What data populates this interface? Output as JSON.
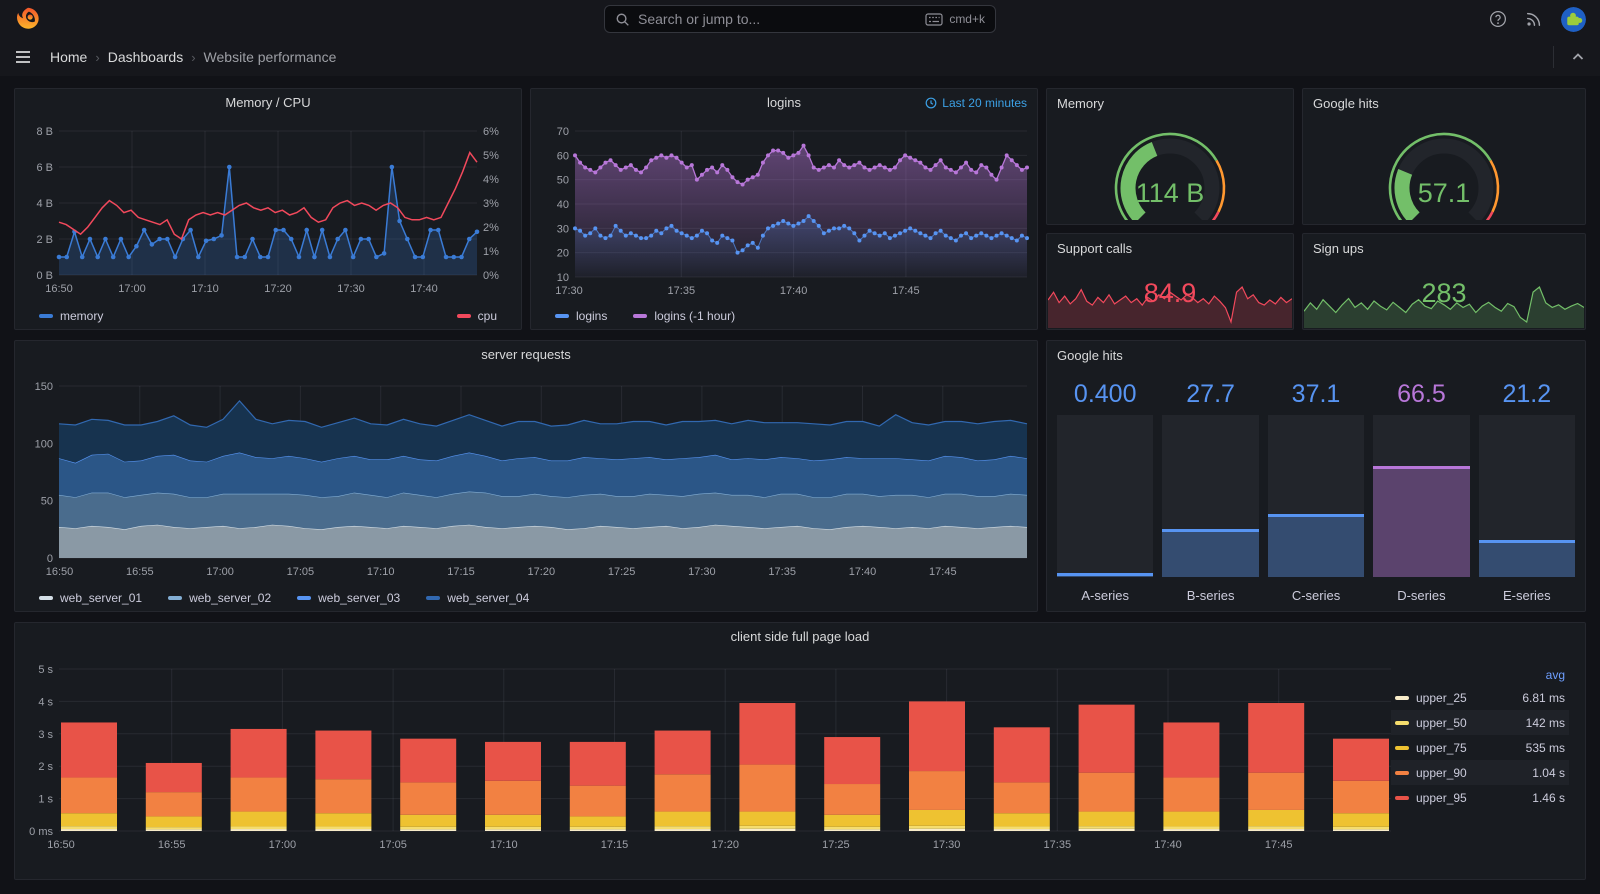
{
  "topbar": {
    "search_placeholder": "Search or jump to...",
    "search_shortcut": "cmd+k"
  },
  "breadcrumb": {
    "home": "Home",
    "section": "Dashboards",
    "current": "Website performance",
    "separator": "›"
  },
  "colors": {
    "background": "#111217",
    "panel": "#181b20",
    "blue": "#5794F2",
    "memory_blue": "#3A7BD5",
    "purple": "#B877D9",
    "red": "#F2495C",
    "green": "#73BF69",
    "orange": "#FF9830",
    "link_blue": "#6E9FFF",
    "time_badge_blue": "#3CA1E6"
  },
  "panels": {
    "mem_cpu": {
      "title": "Memory / CPU",
      "chart_data": {
        "type": "line",
        "x_ticks": [
          "16:50",
          "17:00",
          "17:10",
          "17:20",
          "17:30",
          "17:40"
        ],
        "y_left": {
          "ticks": [
            "0 B",
            "2 B",
            "4 B",
            "6 B",
            "8 B"
          ],
          "lim": [
            0,
            8
          ]
        },
        "y_right": {
          "ticks": [
            "0%",
            "1%",
            "2%",
            "3%",
            "4%",
            "5%",
            "6%"
          ],
          "lim": [
            0,
            6
          ]
        },
        "series": [
          {
            "name": "memory",
            "axis": "left",
            "color": "#3A7BD5",
            "fill": "rgba(58,123,213,0.22)",
            "values": [
              1,
              1,
              2.4,
              1,
              2,
              1,
              2,
              1,
              2,
              1,
              1.6,
              2.5,
              1.7,
              2,
              2,
              1,
              2,
              2.5,
              1,
              1.9,
              2,
              2.2,
              6,
              1,
              1,
              2,
              1,
              1,
              2.5,
              2.5,
              2,
              1,
              2.5,
              1,
              2.5,
              1,
              2,
              2.5,
              1,
              2,
              2,
              1,
              1.2,
              6,
              3,
              2,
              1,
              1,
              2.5,
              2.5,
              1,
              1,
              1,
              2,
              2.4
            ]
          },
          {
            "name": "cpu",
            "axis": "right",
            "color": "#F2495C",
            "values": [
              2.2,
              2.1,
              1.9,
              1.7,
              2.0,
              2.4,
              2.8,
              3.1,
              2.9,
              2.6,
              2.7,
              2.4,
              2.3,
              2.2,
              2.1,
              2.3,
              1.7,
              1.5,
              2.3,
              2.5,
              2.6,
              2.5,
              2.6,
              2.5,
              2.7,
              2.9,
              3.0,
              2.8,
              2.7,
              2.8,
              2.6,
              2.7,
              2.5,
              2.6,
              2.8,
              2.4,
              2.2,
              2.3,
              2.8,
              3.0,
              3.1,
              2.9,
              3.0,
              2.9,
              2.7,
              2.9,
              3.0,
              2.8,
              2.4,
              2.3,
              2.3,
              2.4,
              2.3,
              2.4,
              3.0,
              3.6,
              4.3,
              5.1,
              4.7
            ]
          }
        ]
      }
    },
    "logins": {
      "title": "logins",
      "time_badge": "Last 20 minutes",
      "chart_data": {
        "type": "line",
        "x_ticks": [
          "17:30",
          "17:35",
          "17:40",
          "17:45"
        ],
        "ylim": [
          10,
          70
        ],
        "y_ticks": [
          "10",
          "20",
          "30",
          "40",
          "50",
          "60",
          "70"
        ],
        "series": [
          {
            "name": "logins",
            "color": "#5794F2",
            "values": [
              30,
              29,
              27,
              28,
              30,
              27,
              26,
              27,
              31,
              29,
              27,
              28,
              27,
              26,
              26,
              27,
              29,
              28,
              30,
              31,
              29,
              28,
              27,
              26,
              27,
              29,
              28,
              25,
              24,
              27,
              26,
              25,
              20,
              21,
              23,
              24,
              22,
              27,
              30,
              31,
              32,
              33,
              32,
              31,
              32,
              33,
              35,
              33,
              31,
              28,
              29,
              30,
              30,
              31,
              30,
              28,
              25,
              27,
              29,
              28,
              27,
              28,
              26,
              27,
              28,
              29,
              30,
              29,
              28,
              27,
              26,
              28,
              29,
              27,
              26,
              25,
              27,
              28,
              26,
              27,
              28,
              27,
              26,
              27,
              28,
              27,
              26,
              25,
              27,
              26
            ]
          },
          {
            "name": "logins (-1 hour)",
            "color": "#B877D9",
            "values": [
              60,
              57,
              55,
              54,
              53,
              55,
              57,
              58,
              56,
              54,
              55,
              56,
              54,
              53,
              55,
              58,
              59,
              60,
              59,
              60,
              59,
              57,
              55,
              56,
              50,
              52,
              54,
              55,
              53,
              56,
              54,
              51,
              49,
              48,
              50,
              51,
              52,
              57,
              60,
              62,
              62,
              61,
              59,
              60,
              61,
              64,
              60,
              55,
              54,
              55,
              56,
              55,
              58,
              56,
              55,
              56,
              57,
              55,
              54,
              55,
              56,
              55,
              54,
              55,
              58,
              60,
              59,
              58,
              57,
              55,
              54,
              56,
              58,
              55,
              54,
              53,
              55,
              57,
              54,
              53,
              56,
              55,
              52,
              50,
              55,
              60,
              58,
              56,
              54,
              55
            ]
          }
        ]
      }
    },
    "memory_gauge": {
      "title": "Memory",
      "value": "114 B",
      "value_color": "#73BF69",
      "fill_fraction": 0.42,
      "thresholds": [
        {
          "to": 0.72,
          "color": "#73BF69"
        },
        {
          "to": 0.93,
          "color": "#FF9830"
        },
        {
          "to": 1,
          "color": "#F2495C"
        }
      ]
    },
    "google_gauge": {
      "title": "Google hits",
      "value": "57.1",
      "value_color": "#73BF69",
      "fill_fraction": 0.25,
      "thresholds": [
        {
          "to": 0.72,
          "color": "#73BF69"
        },
        {
          "to": 0.93,
          "color": "#FF9830"
        },
        {
          "to": 1,
          "color": "#F2495C"
        }
      ]
    },
    "support_calls": {
      "title": "Support calls",
      "value": "84.9",
      "color": "#F2495C",
      "spark": [
        82,
        88,
        80,
        85,
        79,
        83,
        90,
        81,
        78,
        84,
        80,
        86,
        79,
        82,
        85,
        80,
        83,
        78,
        84,
        81,
        86,
        83,
        88,
        85,
        82,
        86,
        84,
        80,
        83,
        79,
        85,
        81,
        76,
        65,
        88,
        92,
        83,
        86,
        80,
        78,
        82,
        79,
        84,
        80,
        83
      ]
    },
    "sign_ups": {
      "title": "Sign ups",
      "value": "283",
      "color": "#73BF69",
      "spark": [
        272,
        285,
        275,
        290,
        280,
        270,
        282,
        292,
        278,
        285,
        275,
        288,
        280,
        274,
        286,
        278,
        270,
        283,
        290,
        280,
        276,
        288,
        282,
        275,
        285,
        278,
        283,
        270,
        280,
        286,
        278,
        272,
        284,
        279,
        262,
        255,
        302,
        310,
        285,
        278,
        282,
        275,
        280,
        284,
        278
      ]
    },
    "server_requests": {
      "title": "server requests",
      "chart_data": {
        "type": "area-stacked",
        "x_ticks": [
          "16:50",
          "16:55",
          "17:00",
          "17:05",
          "17:10",
          "17:15",
          "17:20",
          "17:25",
          "17:30",
          "17:35",
          "17:40",
          "17:45"
        ],
        "ylim": [
          0,
          150
        ],
        "y_ticks": [
          "0",
          "50",
          "100",
          "150"
        ],
        "series": [
          {
            "name": "web_server_01",
            "color": "#D4DFE7",
            "fill": "#8A99A5",
            "values": [
              27,
              26,
              28,
              27,
              25,
              28,
              29,
              27,
              26,
              27,
              28,
              26,
              27,
              29,
              28,
              26,
              25,
              27,
              28,
              27,
              26,
              28,
              27,
              26,
              28,
              29,
              27,
              26,
              27,
              28,
              27,
              25,
              26,
              28,
              27,
              26,
              27,
              28,
              26,
              27,
              29,
              28,
              27,
              26,
              27,
              28,
              26,
              25,
              27,
              28,
              27,
              26,
              27,
              26,
              28,
              27,
              26,
              27,
              28,
              27
            ]
          },
          {
            "name": "web_server_02",
            "color": "#83AED4",
            "fill": "#4A6C8D",
            "values": [
              28,
              27,
              29,
              30,
              28,
              27,
              28,
              29,
              27,
              26,
              28,
              30,
              29,
              27,
              28,
              29,
              28,
              27,
              29,
              28,
              27,
              29,
              28,
              27,
              28,
              29,
              30,
              28,
              27,
              28,
              27,
              28,
              29,
              28,
              27,
              28,
              29,
              27,
              28,
              29,
              28,
              27,
              28,
              27,
              29,
              28,
              27,
              28,
              29,
              28,
              27,
              29,
              28,
              27,
              28,
              29,
              28,
              27,
              28,
              28
            ]
          },
          {
            "name": "web_server_03",
            "color": "#5794F2",
            "fill": "#2B5687",
            "values": [
              32,
              30,
              33,
              34,
              31,
              30,
              32,
              34,
              32,
              31,
              33,
              36,
              32,
              31,
              33,
              32,
              31,
              33,
              32,
              31,
              33,
              32,
              31,
              32,
              33,
              34,
              32,
              31,
              33,
              32,
              31,
              32,
              33,
              31,
              32,
              33,
              32,
              31,
              33,
              32,
              33,
              31,
              32,
              33,
              32,
              31,
              32,
              33,
              32,
              31,
              33,
              32,
              31,
              32,
              33,
              32,
              31,
              32,
              33,
              32
            ]
          },
          {
            "name": "web_server_04",
            "color": "#3168B0",
            "fill": "#17334F",
            "values": [
              30,
              33,
              31,
              29,
              32,
              31,
              30,
              34,
              31,
              30,
              32,
              45,
              33,
              30,
              31,
              32,
              30,
              31,
              33,
              31,
              30,
              32,
              31,
              30,
              31,
              33,
              31,
              30,
              32,
              31,
              30,
              31,
              32,
              30,
              31,
              32,
              31,
              30,
              32,
              31,
              30,
              31,
              33,
              32,
              30,
              31,
              32,
              30,
              31,
              32,
              28,
              38,
              32,
              31,
              30,
              31,
              32,
              33,
              31,
              30
            ]
          }
        ]
      }
    },
    "google_bars": {
      "title": "Google hits",
      "chart_data": {
        "type": "bar",
        "categories": [
          "A-series",
          "B-series",
          "C-series",
          "D-series",
          "E-series"
        ],
        "values": [
          0.4,
          27.7,
          37.1,
          66.5,
          21.2
        ],
        "display_values": [
          "0.400",
          "27.7",
          "37.1",
          "66.5",
          "21.2"
        ],
        "max": 100,
        "colors": [
          "#5794F2",
          "#5794F2",
          "#5794F2",
          "#B877D9",
          "#5794F2"
        ],
        "fills": [
          "rgba(87,148,242,0.35)",
          "rgba(87,148,242,0.35)",
          "rgba(87,148,242,0.35)",
          "rgba(184,119,217,0.38)",
          "rgba(87,148,242,0.35)"
        ]
      }
    },
    "client_load": {
      "title": "client side full page load",
      "chart_data": {
        "type": "bar-stacked",
        "x_ticks": [
          "16:50",
          "16:55",
          "17:00",
          "17:05",
          "17:10",
          "17:15",
          "17:20",
          "17:25",
          "17:30",
          "17:35",
          "17:40",
          "17:45"
        ],
        "ylim": [
          0,
          5
        ],
        "y_ticks": [
          "0 ms",
          "1 s",
          "2 s",
          "3 s",
          "4 s",
          "5 s"
        ],
        "series_names": [
          "upper_25",
          "upper_50",
          "upper_75",
          "upper_90",
          "upper_95"
        ],
        "series_colors": [
          "#F8ECC9",
          "#F5DD6D",
          "#EEC231",
          "#F28142",
          "#E85348"
        ],
        "bars_cumulative_s": [
          [
            0.06,
            0.15,
            0.55,
            1.65,
            3.35
          ],
          [
            0.05,
            0.12,
            0.45,
            1.2,
            2.1
          ],
          [
            0.06,
            0.14,
            0.6,
            1.65,
            3.15
          ],
          [
            0.06,
            0.14,
            0.55,
            1.6,
            3.1
          ],
          [
            0.05,
            0.13,
            0.5,
            1.5,
            2.85
          ],
          [
            0.05,
            0.13,
            0.5,
            1.55,
            2.75
          ],
          [
            0.05,
            0.13,
            0.45,
            1.4,
            2.75
          ],
          [
            0.06,
            0.15,
            0.6,
            1.75,
            3.1
          ],
          [
            0.07,
            0.16,
            0.6,
            2.05,
            3.95
          ],
          [
            0.05,
            0.13,
            0.5,
            1.45,
            2.9
          ],
          [
            0.07,
            0.16,
            0.65,
            1.85,
            4.0
          ],
          [
            0.06,
            0.14,
            0.55,
            1.5,
            3.2
          ],
          [
            0.07,
            0.15,
            0.6,
            1.8,
            3.9
          ],
          [
            0.06,
            0.14,
            0.6,
            1.65,
            3.35
          ],
          [
            0.06,
            0.15,
            0.65,
            1.8,
            3.95
          ],
          [
            0.05,
            0.13,
            0.55,
            1.55,
            2.85
          ]
        ]
      },
      "legend": {
        "header": "avg",
        "rows": [
          {
            "name": "upper_25",
            "value": "6.81 ms"
          },
          {
            "name": "upper_50",
            "value": "142 ms"
          },
          {
            "name": "upper_75",
            "value": "535 ms"
          },
          {
            "name": "upper_90",
            "value": "1.04 s"
          },
          {
            "name": "upper_95",
            "value": "1.46 s"
          }
        ]
      }
    }
  }
}
